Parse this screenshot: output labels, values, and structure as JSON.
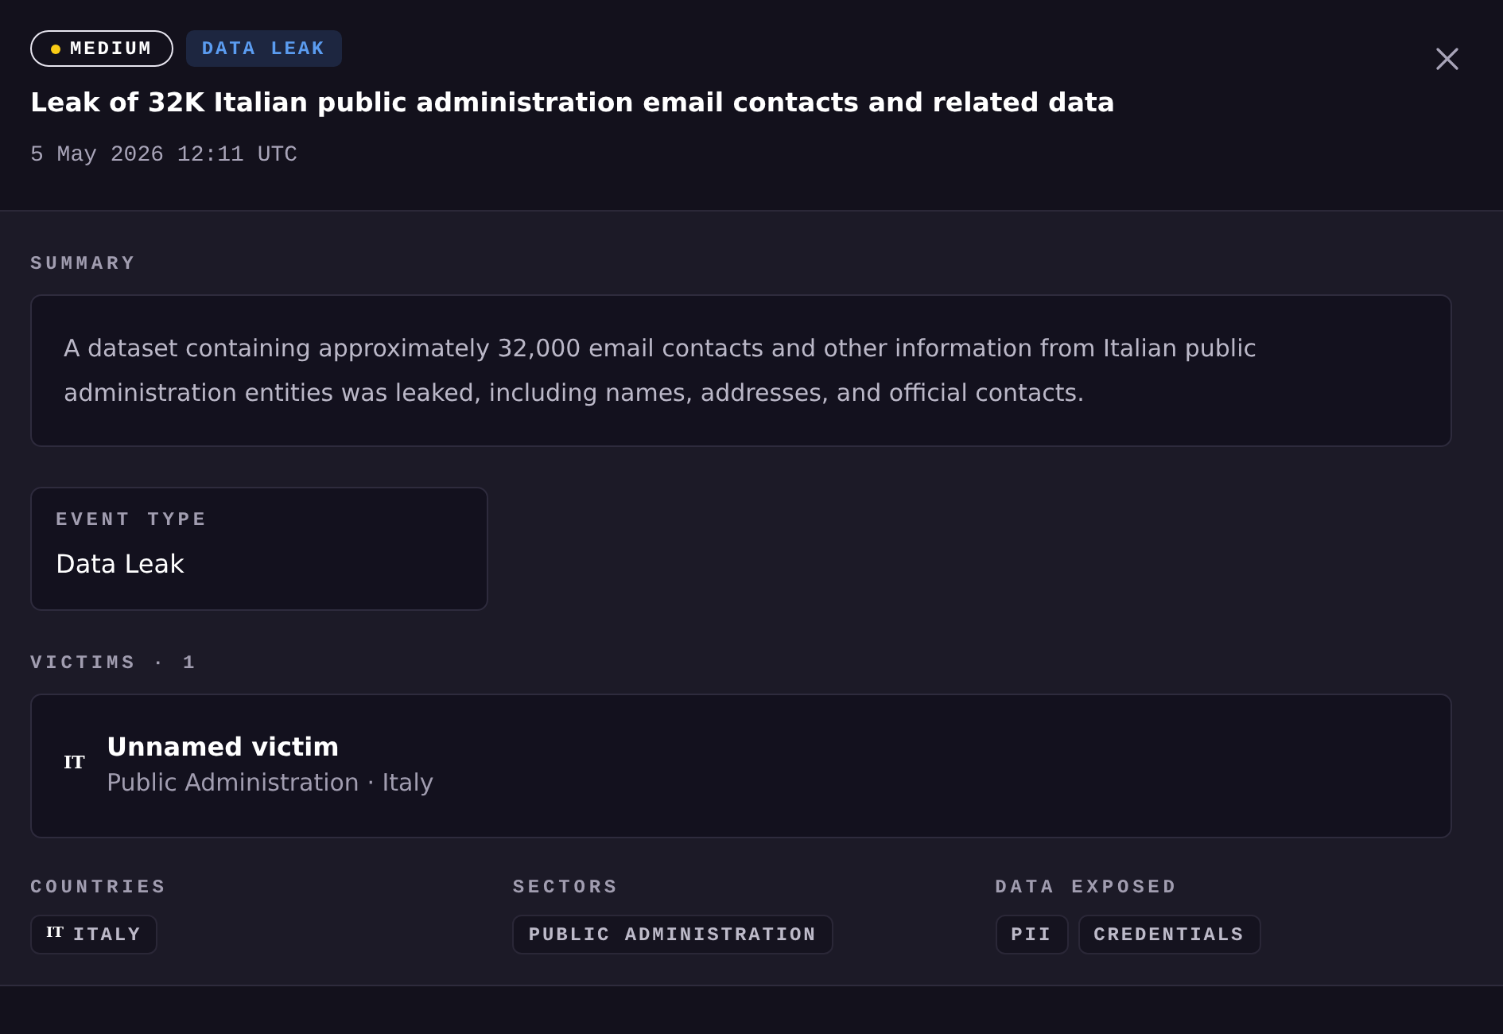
{
  "badges": [
    {
      "kind": "severity",
      "label": "MEDIUM",
      "color": "#facc15"
    },
    {
      "kind": "category",
      "label": "DATA LEAK"
    }
  ],
  "title": "Leak of 32K Italian public administration email contacts and related data",
  "timestamp": "5 May 2026 12:11 UTC",
  "summary": {
    "label": "SUMMARY",
    "text": "A dataset containing approximately 32,000 email contacts and other information from Italian public administration entities was leaked, including names, addresses, and official contacts."
  },
  "event_type": {
    "label": "EVENT TYPE",
    "value": "Data Leak"
  },
  "victims": {
    "label": "VICTIMS · 1",
    "items": [
      {
        "flag": "IT",
        "name": "Unnamed victim",
        "detail": "Public Administration · Italy"
      }
    ]
  },
  "facets": [
    {
      "label": "COUNTRIES",
      "tags": [
        {
          "flag": "IT",
          "text": "ITALY"
        }
      ]
    },
    {
      "label": "SECTORS",
      "tags": [
        {
          "text": "PUBLIC ADMINISTRATION"
        }
      ]
    },
    {
      "label": "DATA EXPOSED",
      "tags": [
        {
          "text": "PII"
        },
        {
          "text": "CREDENTIALS"
        }
      ]
    }
  ]
}
